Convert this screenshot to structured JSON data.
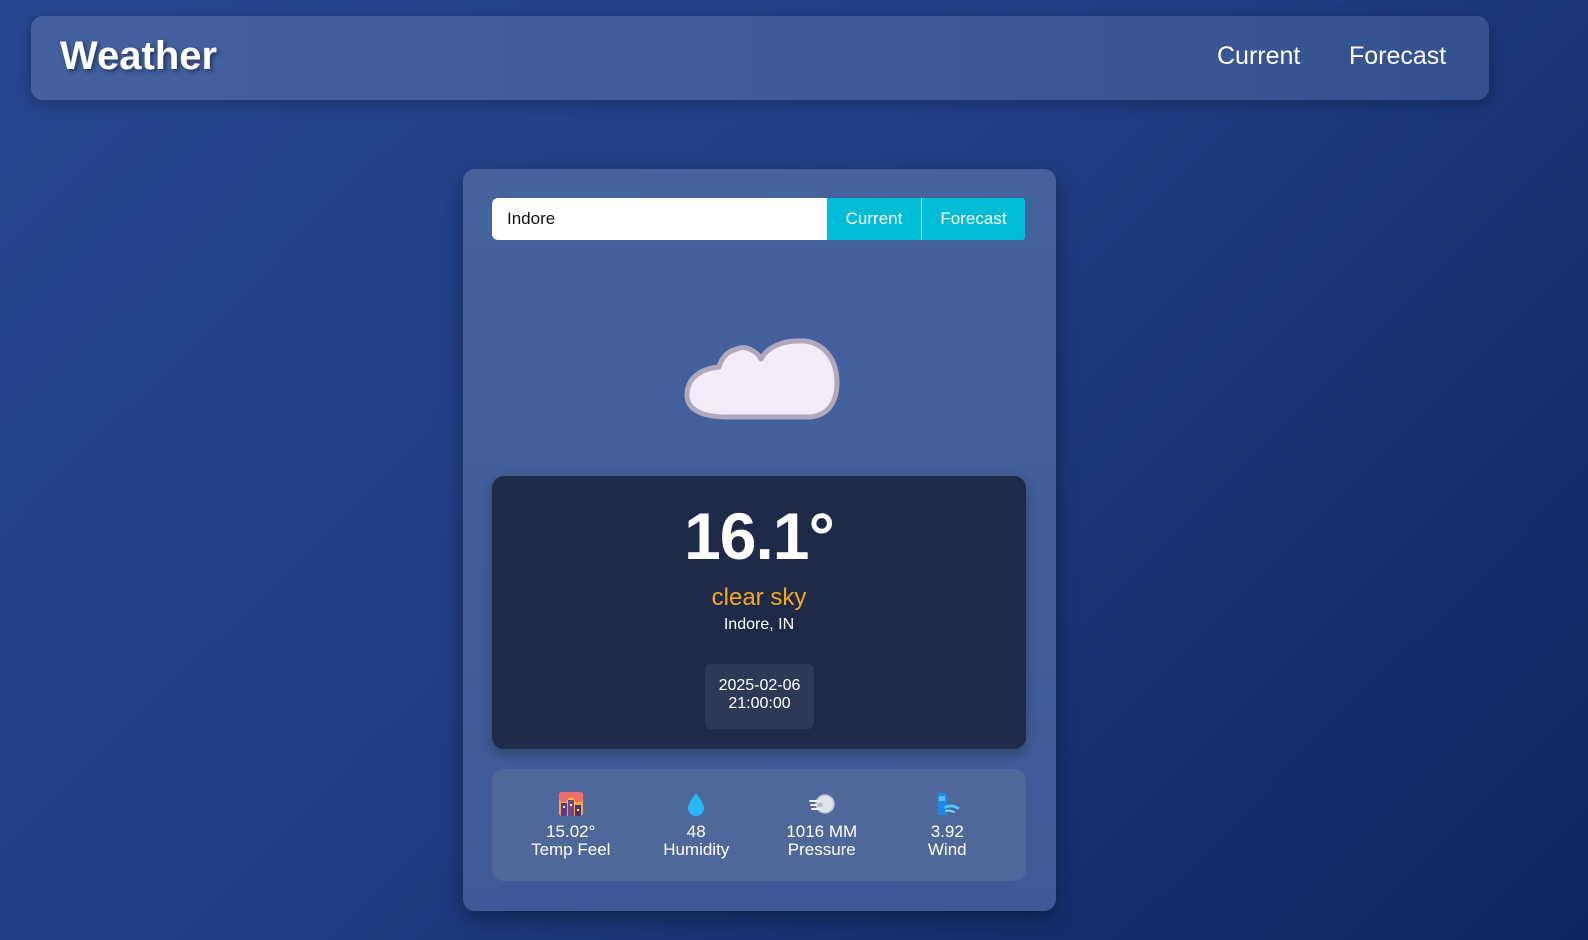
{
  "navbar": {
    "brand": "Weather",
    "links": [
      "Current",
      "Forecast"
    ]
  },
  "search": {
    "value": "Indore",
    "buttons": [
      "Current",
      "Forecast"
    ]
  },
  "weather": {
    "icon": "cloud-icon",
    "temperature": "16.1°",
    "description": "clear sky",
    "location": "Indore, IN",
    "date": "2025-02-06",
    "time": "21:00:00"
  },
  "stats": [
    {
      "icon": "cityscape-icon",
      "value": "15.02°",
      "label": "Temp Feel"
    },
    {
      "icon": "droplet-icon",
      "value": "48",
      "label": "Humidity"
    },
    {
      "icon": "wind-face-icon",
      "value": "1016 MM",
      "label": "Pressure"
    },
    {
      "icon": "wind-icon",
      "value": "3.92",
      "label": "Wind"
    }
  ],
  "colors": {
    "accent": "#00bcd4",
    "description": "#f5a623",
    "panel": "#1e2a47"
  }
}
